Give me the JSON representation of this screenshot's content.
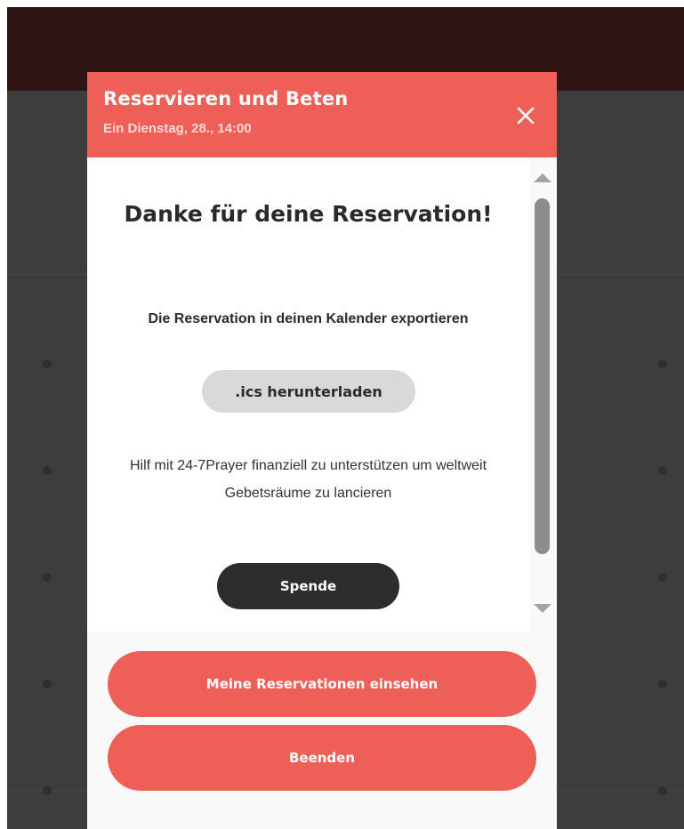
{
  "modal": {
    "title": "Reservieren und Beten",
    "subtitle": "Ein Dienstag, 28., 14:00",
    "close_icon": "close-icon",
    "heading": "Danke für deine Reservation!",
    "export_label": "Die Reservation in deinen Kalender exportieren",
    "ics_button_label": ".ics herunterladen",
    "support_text": "Hilf mit 24-7Prayer finanziell zu unterstützen um weltweit Gebetsräume zu lancieren",
    "donate_button_label": "Spende",
    "view_reservations_label": "Meine Reservationen einsehen",
    "finish_label": "Beenden"
  },
  "colors": {
    "accent": "#ee5f57",
    "dark_button": "#2d2d2d",
    "backdrop": "#3d3d3d",
    "top_band": "#2e1412"
  }
}
